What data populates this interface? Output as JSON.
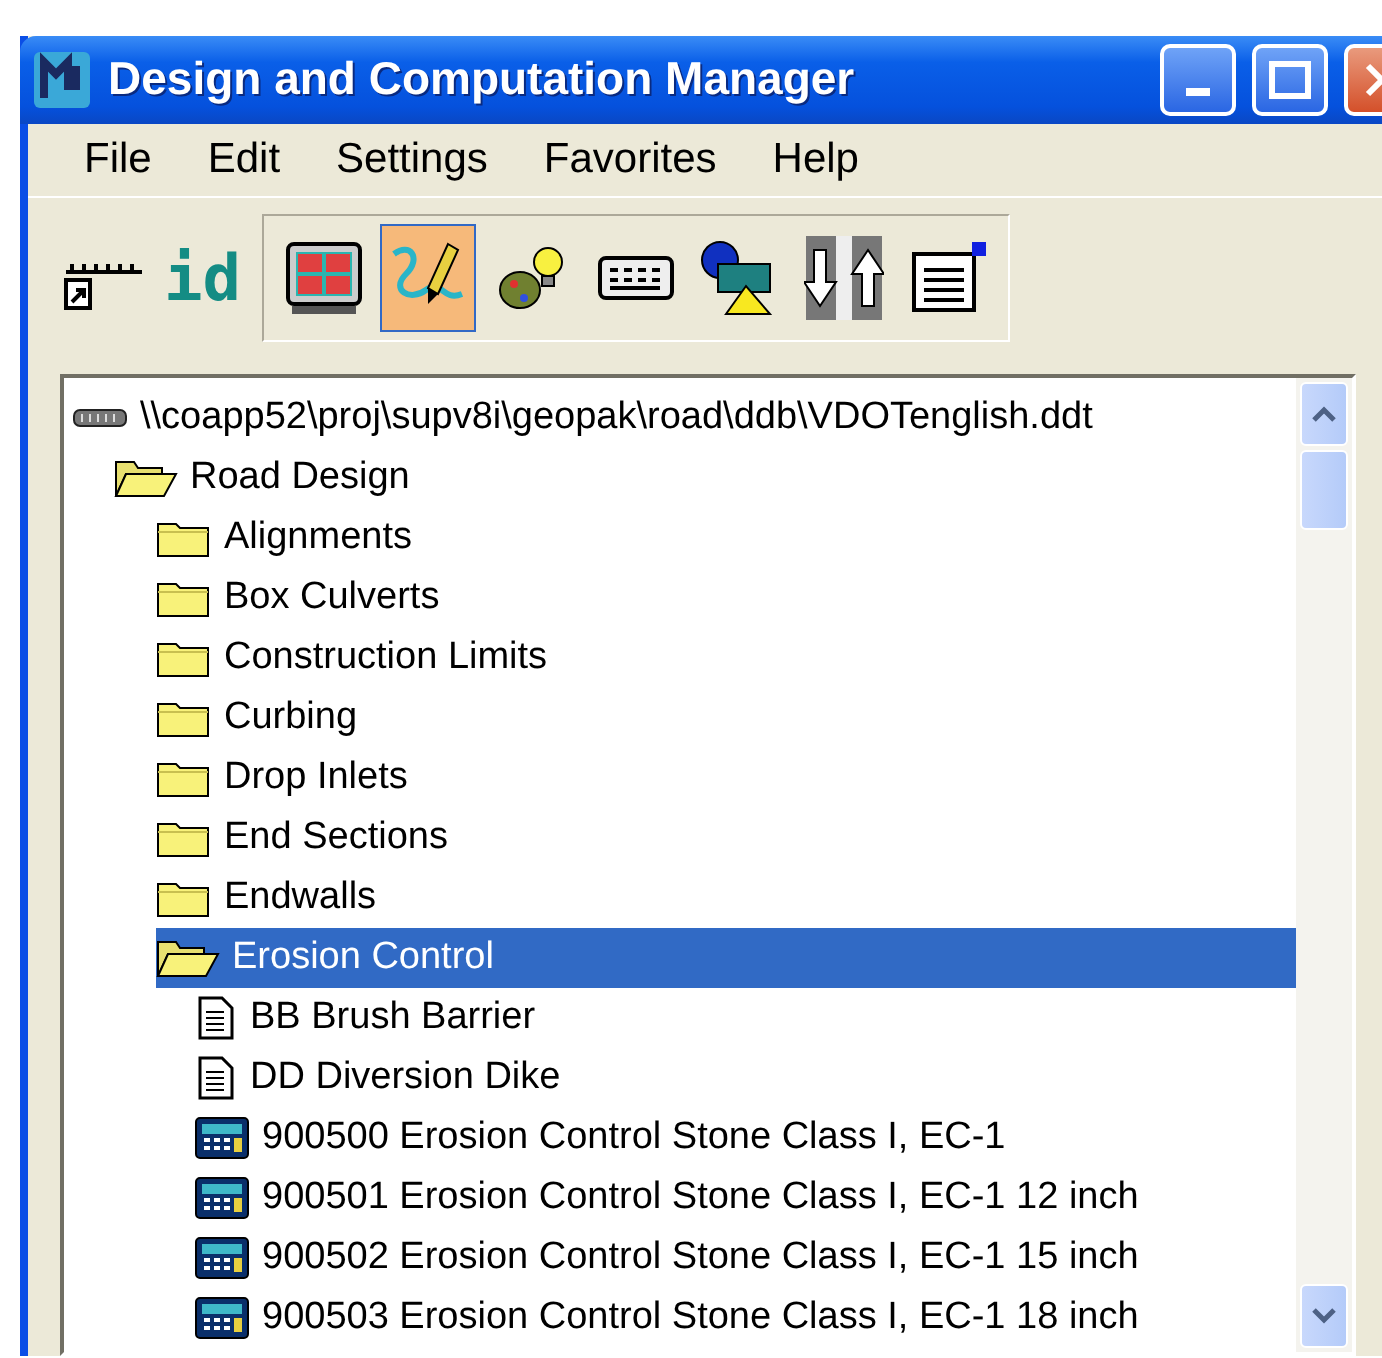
{
  "window": {
    "title": "Design and Computation Manager"
  },
  "menu": [
    {
      "label": "File"
    },
    {
      "label": "Edit"
    },
    {
      "label": "Settings"
    },
    {
      "label": "Favorites"
    },
    {
      "label": "Help"
    }
  ],
  "toolbar": {
    "standalone": [
      {
        "kind": "ruler"
      },
      {
        "kind": "text",
        "label": "id"
      }
    ],
    "group": [
      {
        "kind": "grid",
        "selected": false
      },
      {
        "kind": "draw",
        "selected": true
      },
      {
        "kind": "palette",
        "selected": false
      },
      {
        "kind": "keypad",
        "selected": false
      },
      {
        "kind": "shapes",
        "selected": false
      },
      {
        "kind": "updown",
        "selected": false
      },
      {
        "kind": "clipboard",
        "selected": false
      }
    ]
  },
  "tree": {
    "items": [
      {
        "kind": "database",
        "label": "\\\\coapp52\\proj\\supv8i\\geopak\\road\\ddb\\VDOTenglish.ddt",
        "selected": false,
        "children": [
          {
            "kind": "folder",
            "label": "Road Design",
            "expanded": true,
            "selected": false,
            "children": [
              {
                "kind": "folder",
                "label": "Alignments",
                "expanded": false,
                "selected": false
              },
              {
                "kind": "folder",
                "label": "Box Culverts",
                "expanded": false,
                "selected": false
              },
              {
                "kind": "folder",
                "label": "Construction Limits",
                "expanded": false,
                "selected": false
              },
              {
                "kind": "folder",
                "label": "Curbing",
                "expanded": false,
                "selected": false
              },
              {
                "kind": "folder",
                "label": "Drop Inlets",
                "expanded": false,
                "selected": false
              },
              {
                "kind": "folder",
                "label": "End Sections",
                "expanded": false,
                "selected": false
              },
              {
                "kind": "folder",
                "label": "Endwalls",
                "expanded": false,
                "selected": false
              },
              {
                "kind": "folder",
                "label": "Erosion Control",
                "expanded": true,
                "selected": true,
                "children": [
                  {
                    "kind": "document",
                    "label": "BB Brush Barrier",
                    "selected": false
                  },
                  {
                    "kind": "document",
                    "label": "DD Diversion Dike",
                    "selected": false
                  },
                  {
                    "kind": "item",
                    "label": "900500 Erosion Control Stone Class I, EC-1",
                    "selected": false
                  },
                  {
                    "kind": "item",
                    "label": "900501 Erosion Control Stone Class I, EC-1 12 inch",
                    "selected": false
                  },
                  {
                    "kind": "item",
                    "label": "900502 Erosion Control Stone Class I, EC-1 15 inch",
                    "selected": false
                  },
                  {
                    "kind": "item",
                    "label": "900503 Erosion Control Stone Class I, EC-1 18 inch",
                    "selected": false
                  }
                ]
              }
            ]
          }
        ]
      }
    ]
  }
}
